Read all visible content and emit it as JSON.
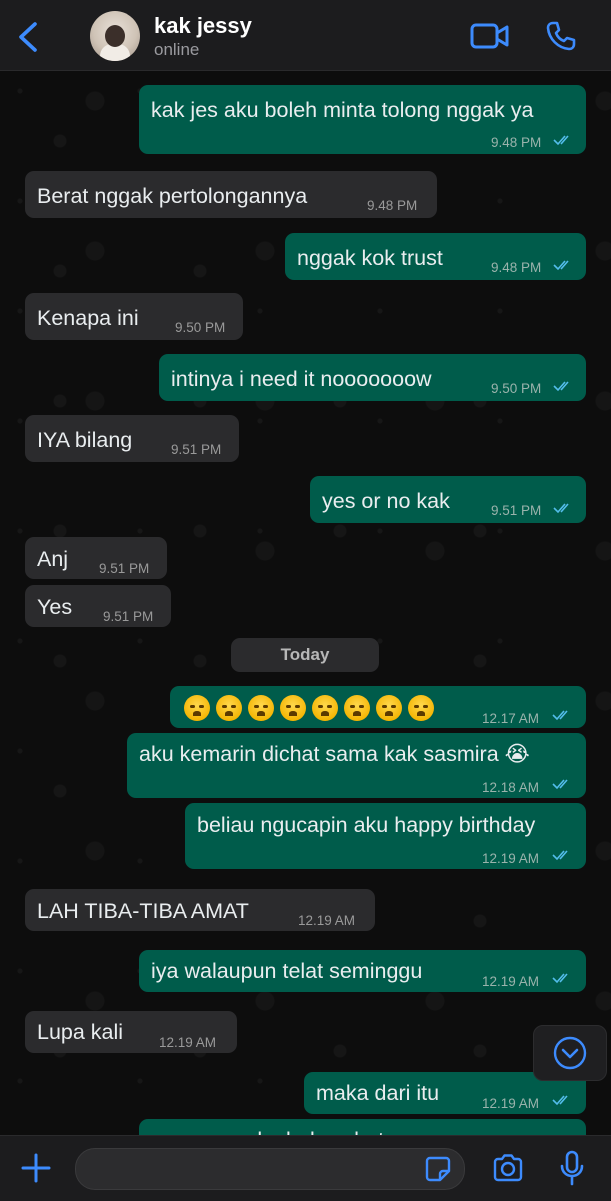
{
  "colors": {
    "accent": "#3d8bfd",
    "outgoing_bubble": "#005c4b",
    "incoming_bubble": "#2b2b2d",
    "read_tick": "#53bdeb"
  },
  "header": {
    "name": "kak jessy",
    "status": "online",
    "icons": [
      "chevron-left-icon",
      "video-call-icon",
      "phone-icon"
    ]
  },
  "date_separator": "Today",
  "messages": [
    {
      "dir": "out",
      "text": "kak jes aku boleh minta tolong nggak ya",
      "time": "9.48 PM",
      "read": true
    },
    {
      "dir": "in",
      "text": "Berat nggak pertolongannya",
      "time": "9.48 PM"
    },
    {
      "dir": "out",
      "text": "nggak kok trust",
      "time": "9.48 PM",
      "read": true
    },
    {
      "dir": "in",
      "text": "Kenapa ini",
      "time": "9.50 PM"
    },
    {
      "dir": "out",
      "text": "intinya i need it nooooooow",
      "time": "9.50 PM",
      "read": true
    },
    {
      "dir": "in",
      "text": "IYA bilang",
      "time": "9.51 PM"
    },
    {
      "dir": "out",
      "text": "yes or no kak",
      "time": "9.51 PM",
      "read": true
    },
    {
      "dir": "in",
      "text": "Anj",
      "time": "9.51 PM"
    },
    {
      "dir": "in",
      "text": "Yes",
      "time": "9.51 PM"
    },
    {
      "dir": "out",
      "text": "😭😭😭😭😭😭😭😭",
      "emoji_count": 8,
      "time": "12.17 AM",
      "read": true
    },
    {
      "dir": "out",
      "text": "aku kemarin dichat sama kak sasmira 😭",
      "time": "12.18 AM",
      "read": true
    },
    {
      "dir": "out",
      "text": "beliau ngucapin aku happy birthday",
      "time": "12.19 AM",
      "read": true
    },
    {
      "dir": "in",
      "text": "LAH TIBA-TIBA AMAT",
      "time": "12.19 AM"
    },
    {
      "dir": "out",
      "text": "iya walaupun telat seminggu",
      "time": "12.19 AM",
      "read": true
    },
    {
      "dir": "in",
      "text": "Lupa kali",
      "time": "12.19 AM"
    },
    {
      "dir": "out",
      "text": "maka dari itu",
      "time": "12.19 AM",
      "read": true
    },
    {
      "dir": "out",
      "text": "yes or no aku bales chatnya",
      "partially_visible": true
    }
  ],
  "composer": {
    "value": "",
    "icons": [
      "plus-icon",
      "sticker-icon",
      "camera-icon",
      "microphone-icon"
    ]
  },
  "scroll_button_icon": "chevron-down-circle-icon"
}
